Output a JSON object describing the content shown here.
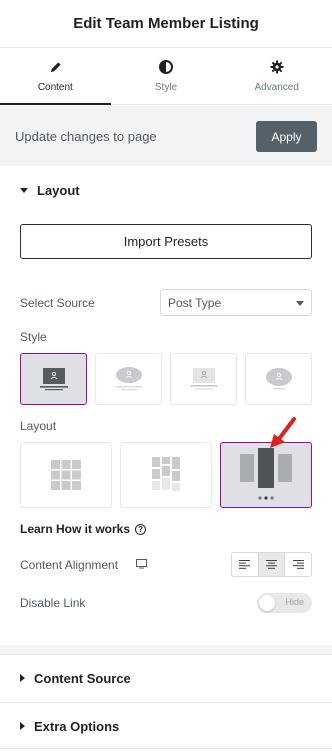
{
  "header": {
    "title": "Edit Team Member Listing"
  },
  "tabs": [
    {
      "label": "Content",
      "icon": "pencil-icon",
      "active": true
    },
    {
      "label": "Style",
      "icon": "half-circle-icon",
      "active": false
    },
    {
      "label": "Advanced",
      "icon": "gear-icon",
      "active": false
    }
  ],
  "update": {
    "text": "Update changes to page",
    "apply_label": "Apply"
  },
  "layout_section": {
    "title": "Layout",
    "import_label": "Import Presets",
    "select_source_label": "Select Source",
    "select_source_value": "Post Type",
    "style_label": "Style",
    "layout_label": "Layout",
    "learn_label": "Learn How it works",
    "content_alignment_label": "Content Alignment",
    "disable_link_label": "Disable Link",
    "disable_link_toggle": "Hide"
  },
  "collapsed_sections": [
    {
      "title": "Content Source"
    },
    {
      "title": "Extra Options"
    }
  ],
  "colors": {
    "accent": "#9b0a9b",
    "arrow": "#e0201a",
    "apply_bg": "#556068"
  }
}
